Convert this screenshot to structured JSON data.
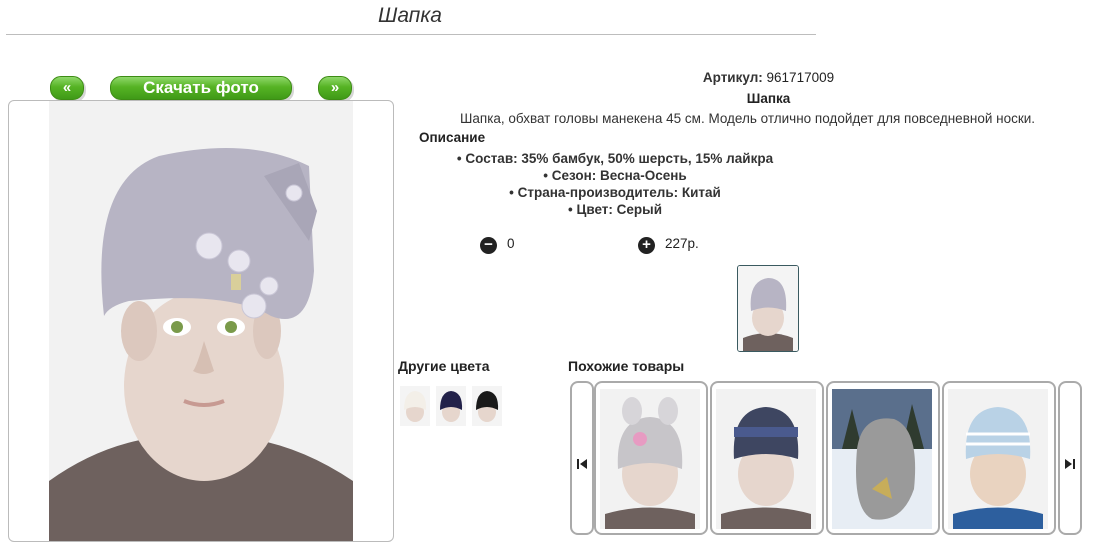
{
  "page": {
    "title": "Шапка"
  },
  "gallery": {
    "prev_label": "«",
    "download_label": "Скачать фото",
    "next_label": "»"
  },
  "product": {
    "article_label": "Артикул:",
    "article_value": "961717009",
    "name": "Шапка",
    "description": "Шапка, обхват головы манекена 45 см. Модель отлично подойдет для повседневной носки.",
    "description_heading": "Описание",
    "specs": [
      "Состав: 35% бамбук, 50% шерсть, 15% лайкра",
      "Сезон: Весна-Осень",
      "Страна-производитель: Китай",
      "Цвет: Серый"
    ]
  },
  "cart": {
    "quantity": "0",
    "price": "227р."
  },
  "sections": {
    "other_colors": "Другие цвета",
    "similar": "Похожие товары"
  },
  "colors": {
    "hat_main": "#b7b4c4",
    "turtleneck": "#6e615e",
    "button_green": "#4fae22"
  }
}
